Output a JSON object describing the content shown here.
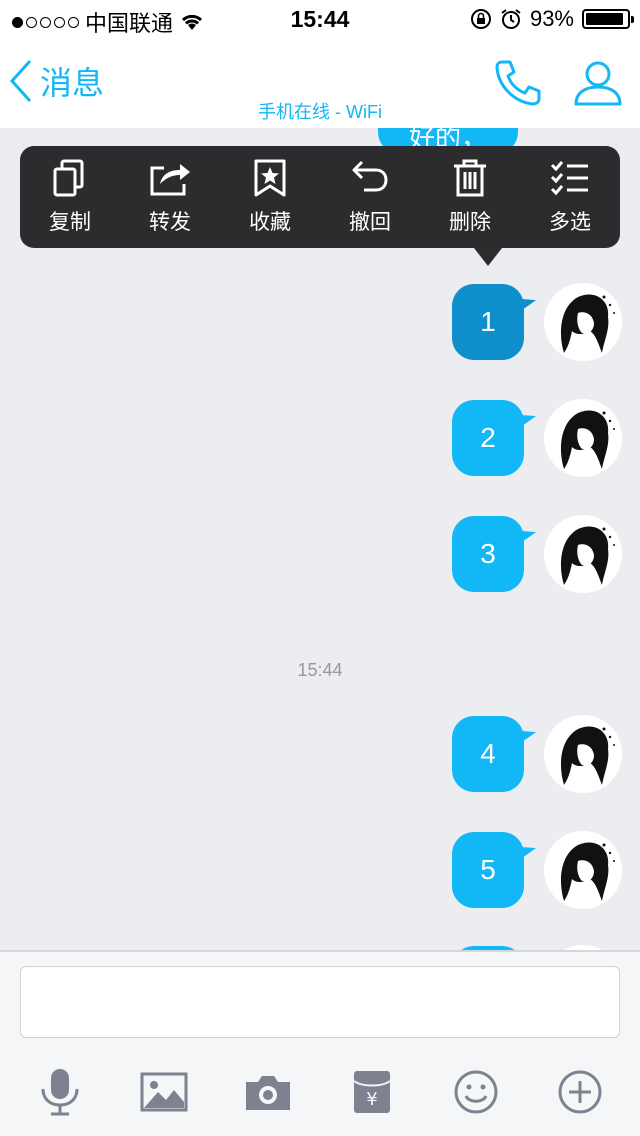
{
  "status_bar": {
    "carrier": "中国联通",
    "time": "15:44",
    "battery": "93%",
    "battery_level": 0.93,
    "signal_dots": 5,
    "signal_filled": 1
  },
  "nav": {
    "back_label": "消息",
    "subtitle": "手机在线 - WiFi"
  },
  "colors": {
    "accent": "#12b7f5",
    "bubble_selected": "#0e8fcc",
    "menu_bg": "#2c2c2e"
  },
  "context_menu": [
    {
      "label": "复制",
      "icon": "copy-icon"
    },
    {
      "label": "转发",
      "icon": "forward-icon"
    },
    {
      "label": "收藏",
      "icon": "bookmark-icon"
    },
    {
      "label": "撤回",
      "icon": "undo-icon"
    },
    {
      "label": "删除",
      "icon": "trash-icon"
    },
    {
      "label": "多选",
      "icon": "checklist-icon"
    }
  ],
  "chat": {
    "partial_top_message": "好的，",
    "messages": [
      {
        "text": "1",
        "selected": true
      },
      {
        "text": "2",
        "selected": false
      },
      {
        "text": "3",
        "selected": false
      },
      {
        "text": "4",
        "selected": false
      },
      {
        "text": "5",
        "selected": false
      }
    ],
    "timestamp": "15:44"
  },
  "input": {
    "value": "",
    "placeholder": ""
  },
  "toolbar": [
    {
      "icon": "microphone-icon"
    },
    {
      "icon": "image-icon"
    },
    {
      "icon": "camera-icon"
    },
    {
      "icon": "red-packet-icon"
    },
    {
      "icon": "emoji-icon"
    },
    {
      "icon": "plus-circle-icon"
    }
  ]
}
